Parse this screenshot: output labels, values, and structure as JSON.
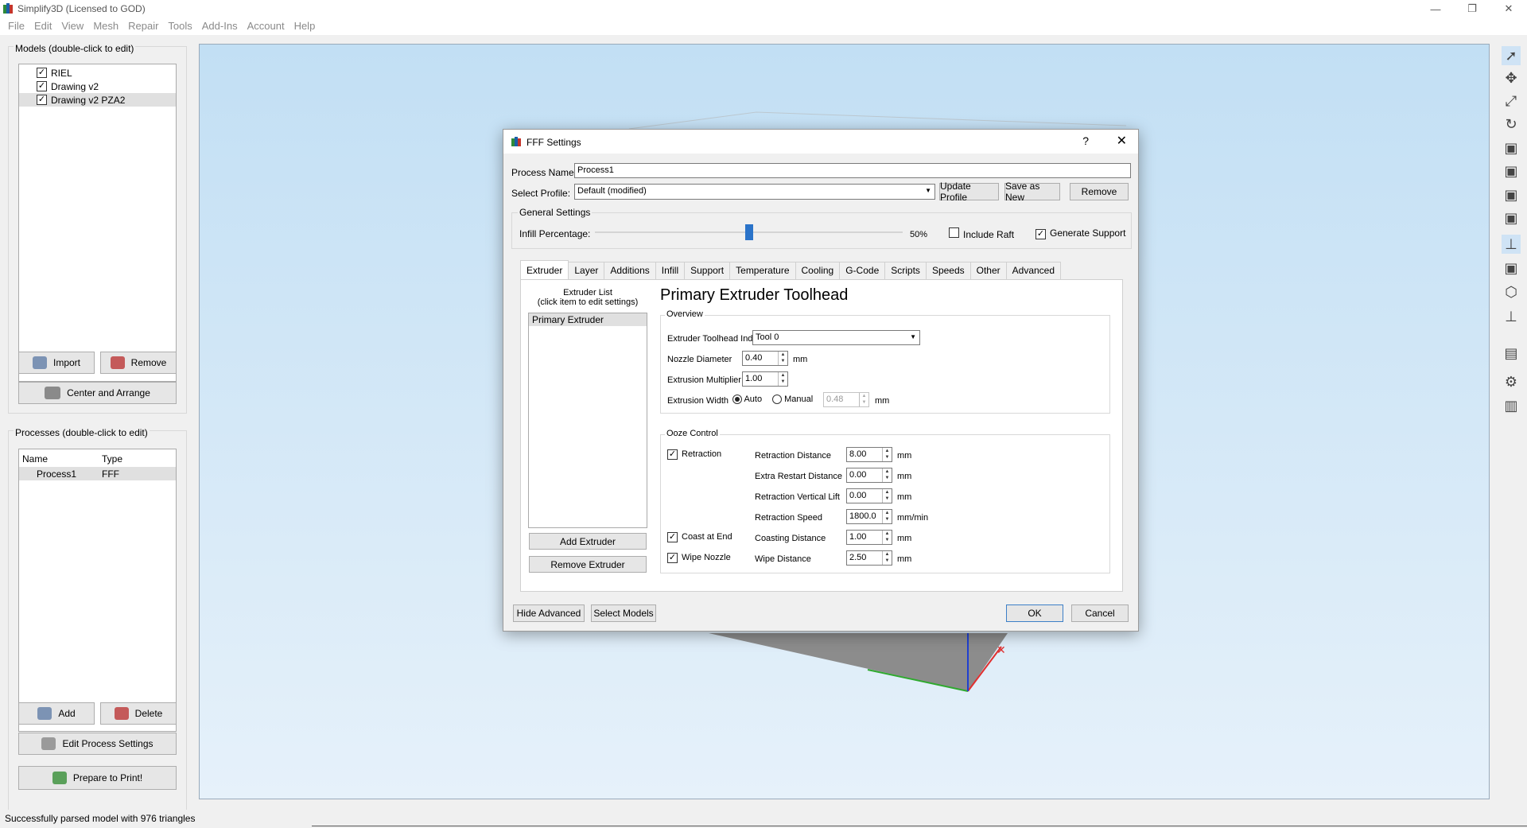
{
  "window": {
    "title": "Simplify3D (Licensed to GOD)",
    "controls": [
      "—",
      "❐",
      "✕"
    ]
  },
  "menu": [
    "File",
    "Edit",
    "View",
    "Mesh",
    "Repair",
    "Tools",
    "Add-Ins",
    "Account",
    "Help"
  ],
  "models": {
    "header": "Models (double-click to edit)",
    "items": [
      {
        "label": "RIEL",
        "checked": true
      },
      {
        "label": "Drawing v2",
        "checked": true
      },
      {
        "label": "Drawing v2 PZA2",
        "checked": true
      }
    ],
    "import_label": "Import",
    "remove_label": "Remove",
    "center_arrange_label": "Center and Arrange"
  },
  "processes": {
    "header": "Processes (double-click to edit)",
    "col_name": "Name",
    "col_type": "Type",
    "rows": [
      {
        "name": "Process1",
        "type": "FFF"
      }
    ],
    "add_label": "Add",
    "delete_label": "Delete",
    "edit_label": "Edit Process Settings",
    "prepare_label": "Prepare to Print!"
  },
  "status": "Successfully parsed model with 976 triangles",
  "dialog": {
    "title": "FFF Settings",
    "help": "?",
    "close": "✕",
    "process_name_label": "Process Name:",
    "process_name_value": "Process1",
    "select_profile_label": "Select Profile:",
    "select_profile_value": "Default (modified)",
    "update_profile_label": "Update Profile",
    "save_as_new_label": "Save as New",
    "remove_label": "Remove",
    "general_settings_label": "General Settings",
    "infill_label": "Infill Percentage:",
    "infill_value": "50%",
    "infill_fraction": 0.5,
    "include_raft_label": "Include Raft",
    "include_raft_checked": false,
    "generate_support_label": "Generate Support",
    "generate_support_checked": true,
    "tabs": [
      "Extruder",
      "Layer",
      "Additions",
      "Infill",
      "Support",
      "Temperature",
      "Cooling",
      "G-Code",
      "Scripts",
      "Speeds",
      "Other",
      "Advanced"
    ],
    "active_tab": "Extruder",
    "extruder_list_title": "Extruder List",
    "extruder_list_hint": "(click item to edit settings)",
    "extruders": [
      "Primary Extruder"
    ],
    "add_extruder_label": "Add Extruder",
    "remove_extruder_label": "Remove Extruder",
    "heading": "Primary Extruder Toolhead",
    "overview_label": "Overview",
    "toolhead_index_label": "Extruder Toolhead Index",
    "toolhead_index_value": "Tool 0",
    "nozzle_label": "Nozzle Diameter",
    "nozzle_value": "0.40",
    "nozzle_unit": "mm",
    "multiplier_label": "Extrusion Multiplier",
    "multiplier_value": "1.00",
    "width_label": "Extrusion Width",
    "width_auto_label": "Auto",
    "width_manual_label": "Manual",
    "width_value": "0.48",
    "width_unit": "mm",
    "ooze_label": "Ooze Control",
    "retraction_label": "Retraction",
    "coast_label": "Coast at End",
    "wipe_label": "Wipe Nozzle",
    "ooze_rows": [
      {
        "label": "Retraction Distance",
        "value": "8.00",
        "unit": "mm"
      },
      {
        "label": "Extra Restart Distance",
        "value": "0.00",
        "unit": "mm"
      },
      {
        "label": "Retraction Vertical Lift",
        "value": "0.00",
        "unit": "mm"
      },
      {
        "label": "Retraction Speed",
        "value": "1800.0",
        "unit": "mm/min"
      },
      {
        "label": "Coasting Distance",
        "value": "1.00",
        "unit": "mm"
      },
      {
        "label": "Wipe Distance",
        "value": "2.50",
        "unit": "mm"
      }
    ],
    "hide_advanced_label": "Hide Advanced",
    "select_models_label": "Select Models",
    "ok_label": "OK",
    "cancel_label": "Cancel"
  }
}
